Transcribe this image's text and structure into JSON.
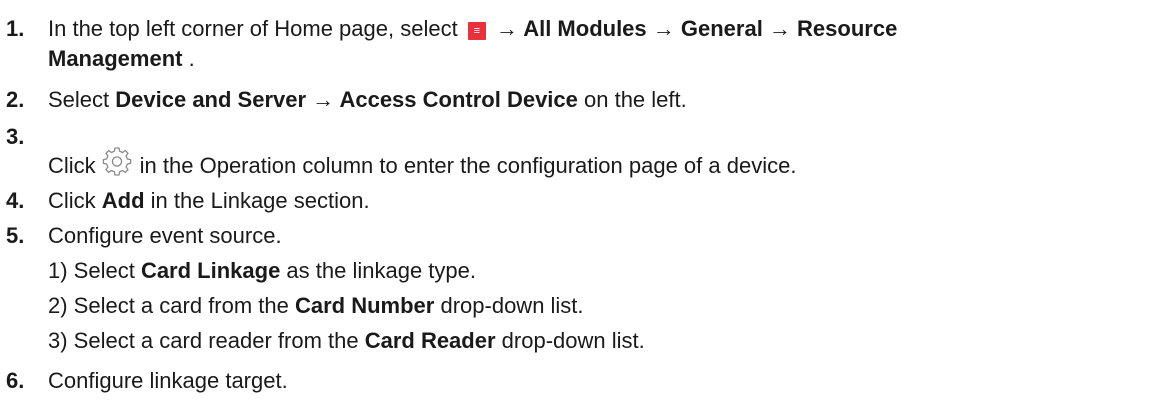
{
  "steps": [
    {
      "num": "1.",
      "a": "In the top left corner of Home page, select ",
      "menu_icon_glyph": "≡",
      "b": " → All Modules → General → Resource",
      "c": "Management",
      "d": " ."
    },
    {
      "num": "2.",
      "a": "Select ",
      "b": "Device and Server → Access Control Device",
      "c": " on the left."
    },
    {
      "num": "3.",
      "a": "Click",
      "b": "in the Operation column to enter the configuration page of a device."
    },
    {
      "num": "4.",
      "a": "Click ",
      "b": "Add",
      "c": " in the Linkage section."
    },
    {
      "num": "5.",
      "a": "Configure event source."
    },
    {
      "num": "6.",
      "a": "Configure linkage target."
    }
  ],
  "substeps": [
    {
      "num": "1)",
      "a": " Select ",
      "b": "Card Linkage",
      "c": " as the linkage type."
    },
    {
      "num": "2)",
      "a": " Select a card from the ",
      "b": "Card Number",
      "c": " drop-down list."
    },
    {
      "num": "3)",
      "a": " Select a card reader from the ",
      "b": "Card Reader",
      "c": " drop-down list."
    }
  ],
  "icons": {
    "menu": "menu-icon",
    "settings": "gear-icon"
  },
  "colors": {
    "menu_icon_bg": "#e8313a",
    "text": "#1a1a1a",
    "gear_stroke": "#8a8a8a"
  }
}
